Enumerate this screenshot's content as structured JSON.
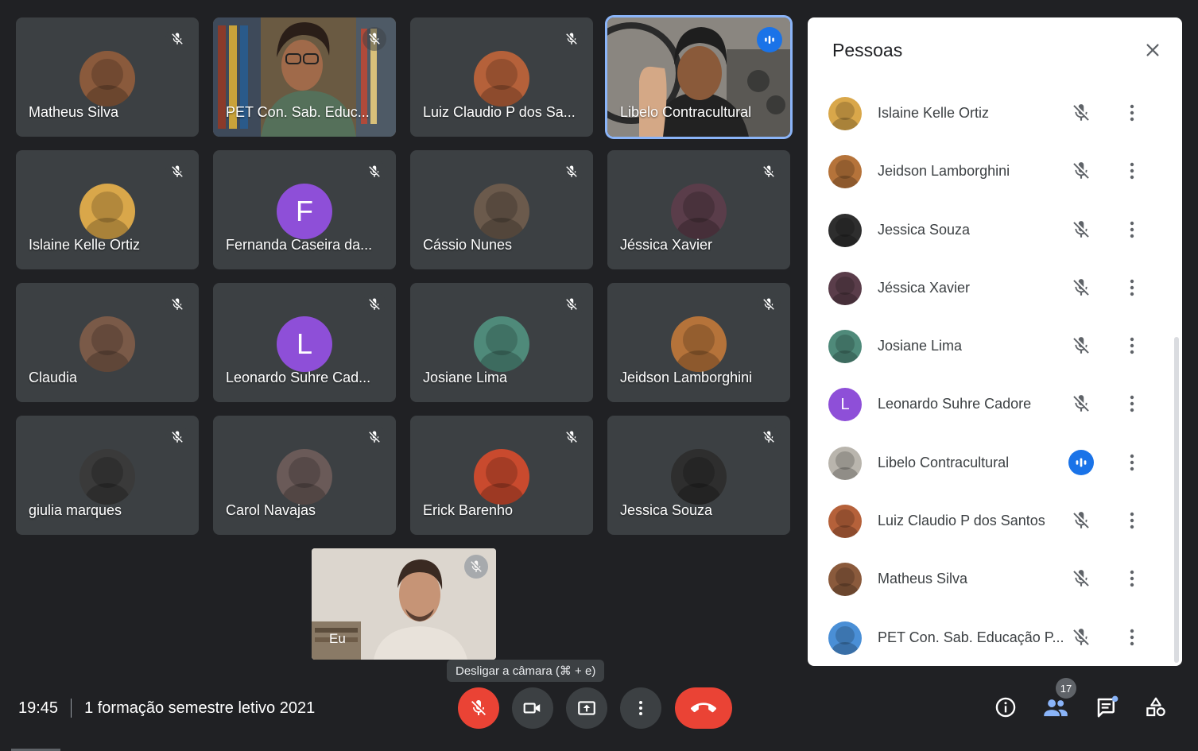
{
  "colors": {
    "background": "#202124",
    "tile": "#3c4043",
    "accent_blue": "#1a73e8",
    "danger_red": "#ea4335",
    "letter_avatar": "#8e4fd8"
  },
  "tiles": [
    {
      "name": "Matheus Silva",
      "kind": "photo",
      "color": "#8a5a3c",
      "icon": "mic-off-icon"
    },
    {
      "name": "PET Con. Sab. Educ...",
      "kind": "video",
      "icon": "mic-off-icon"
    },
    {
      "name": "Luiz Claudio P dos Sa...",
      "kind": "photo",
      "color": "#b5613a",
      "icon": "mic-off-icon"
    },
    {
      "name": "Libelo Contracultural",
      "kind": "video-active",
      "icon": "speaking-icon"
    },
    {
      "name": "Islaine Kelle Ortiz",
      "kind": "photo",
      "color": "#d9a74a",
      "icon": "mic-off-icon"
    },
    {
      "name": "Fernanda Caseira da...",
      "kind": "letter",
      "letter": "F",
      "icon": "mic-off-icon"
    },
    {
      "name": "Cássio Nunes",
      "kind": "photo",
      "color": "#6b5a4c",
      "icon": "mic-off-icon"
    },
    {
      "name": "Jéssica Xavier",
      "kind": "photo",
      "color": "#5a3d4a",
      "icon": "mic-off-icon"
    },
    {
      "name": "Claudia",
      "kind": "photo",
      "color": "#7a5a48",
      "icon": "mic-off-icon"
    },
    {
      "name": "Leonardo Suhre Cad...",
      "kind": "letter",
      "letter": "L",
      "icon": "mic-off-icon"
    },
    {
      "name": "Josiane Lima",
      "kind": "photo",
      "color": "#4f8a7a",
      "icon": "mic-off-icon"
    },
    {
      "name": "Jeidson Lamborghini",
      "kind": "photo",
      "color": "#b5733a",
      "icon": "mic-off-icon"
    },
    {
      "name": "giulia marques",
      "kind": "photo",
      "color": "#3a3a3a",
      "icon": "mic-off-icon"
    },
    {
      "name": "Carol Navajas",
      "kind": "photo",
      "color": "#6a5a58",
      "icon": "mic-off-icon"
    },
    {
      "name": "Erick Barenho",
      "kind": "photo",
      "color": "#c94a2e",
      "icon": "mic-off-icon"
    },
    {
      "name": "Jessica Souza",
      "kind": "photo",
      "color": "#2e2e2e",
      "icon": "mic-off-icon"
    }
  ],
  "self_view": {
    "name": "Eu"
  },
  "tooltip": "Desligar a câmara (⌘ + e)",
  "meeting": {
    "time": "19:45",
    "title": "1 formação semestre letivo 2021"
  },
  "participant_count": "17",
  "panel": {
    "title": "Pessoas",
    "people": [
      {
        "name": "Islaine Kelle Ortiz",
        "kind": "photo",
        "color": "#d9a74a",
        "status": "muted"
      },
      {
        "name": "Jeidson Lamborghini",
        "kind": "photo",
        "color": "#b5733a",
        "status": "muted"
      },
      {
        "name": "Jessica Souza",
        "kind": "photo",
        "color": "#2e2e2e",
        "status": "muted"
      },
      {
        "name": "Jéssica Xavier",
        "kind": "photo",
        "color": "#5a3d4a",
        "status": "muted"
      },
      {
        "name": "Josiane Lima",
        "kind": "photo",
        "color": "#4f8a7a",
        "status": "muted"
      },
      {
        "name": "Leonardo Suhre Cadore",
        "kind": "letter",
        "letter": "L",
        "status": "muted"
      },
      {
        "name": "Libelo Contracultural",
        "kind": "photo",
        "color": "#b9b5ad",
        "status": "speaking"
      },
      {
        "name": "Luiz Claudio P dos Santos",
        "kind": "photo",
        "color": "#b5613a",
        "status": "muted"
      },
      {
        "name": "Matheus Silva",
        "kind": "photo",
        "color": "#8a5a3c",
        "status": "muted"
      },
      {
        "name": "PET Con. Sab. Educação P...",
        "kind": "photo",
        "color": "#4a8fd6",
        "status": "muted"
      }
    ]
  }
}
